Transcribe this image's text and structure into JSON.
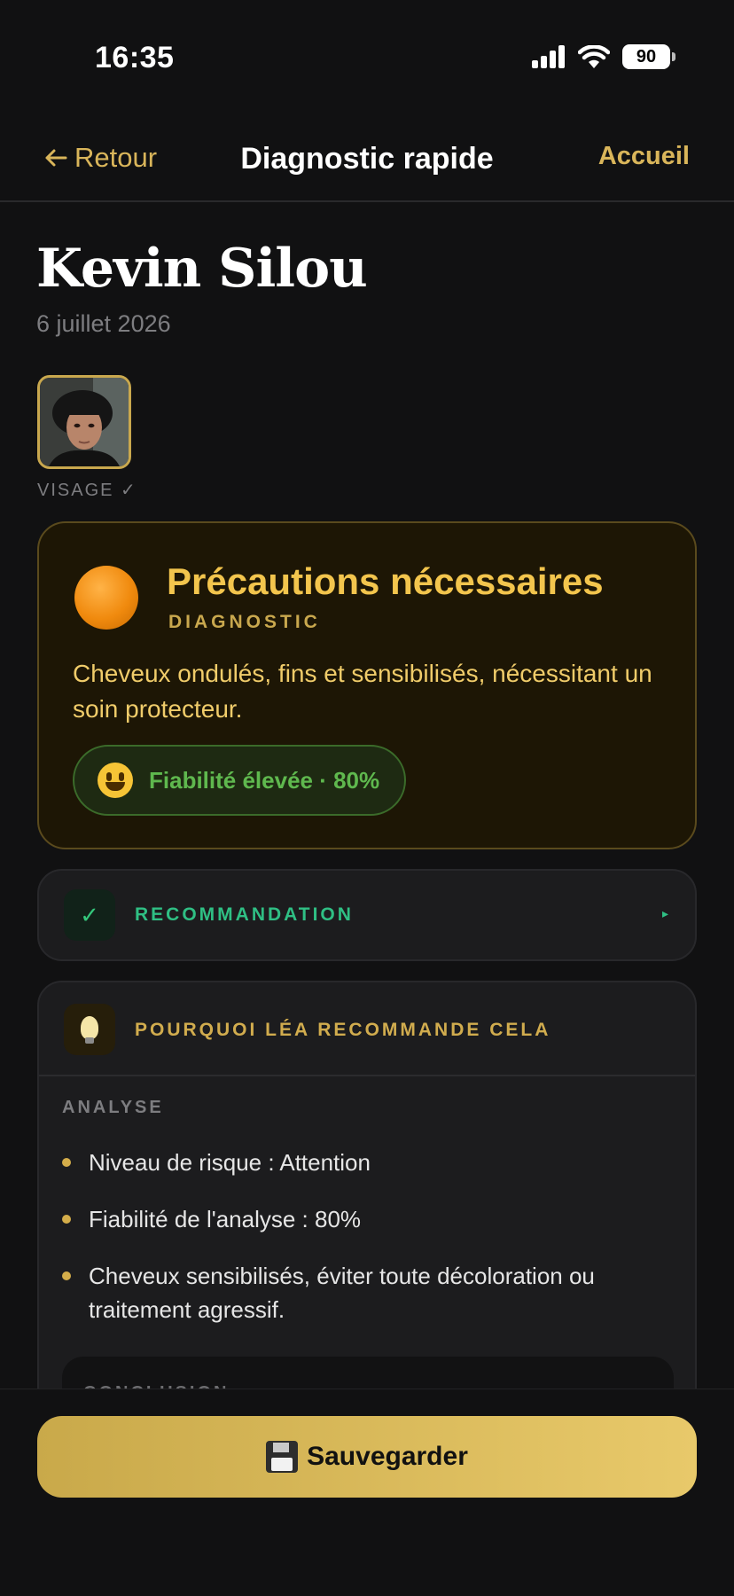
{
  "status_bar": {
    "time": "16:35",
    "battery": "90"
  },
  "nav": {
    "back_label": "Retour",
    "title": "Diagnostic rapide",
    "home_label": "Accueil"
  },
  "client": {
    "name": "Kevin Silou",
    "date": "6 juillet 2026"
  },
  "photo": {
    "label": "VISAGE ✓"
  },
  "diagnostic": {
    "title": "Précautions nécessaires",
    "subtitle": "DIAGNOSTIC",
    "text": "Cheveux ondulés, fins et sensibilisés, nécessitant un soin protecteur.",
    "reliability": "Fiabilité élevée · 80%",
    "accent": "#f3c54d"
  },
  "recommendation": {
    "label": "RECOMMANDATION",
    "icon": "check-icon",
    "arrow": "▸"
  },
  "why": {
    "label": "POURQUOI LÉA RECOMMANDE CELA",
    "icon": "lightbulb-icon",
    "analysis_label": "ANALYSE",
    "bullets": [
      "Niveau de risque : Attention",
      "Fiabilité de l'analyse : 80%",
      "Cheveux sensibilisés, éviter toute décoloration ou traitement agressif."
    ],
    "conclusion_label": "CONCLUSION"
  },
  "actions": {
    "save_label": "Sauvegarder",
    "save_icon": "floppy-disk-icon"
  }
}
